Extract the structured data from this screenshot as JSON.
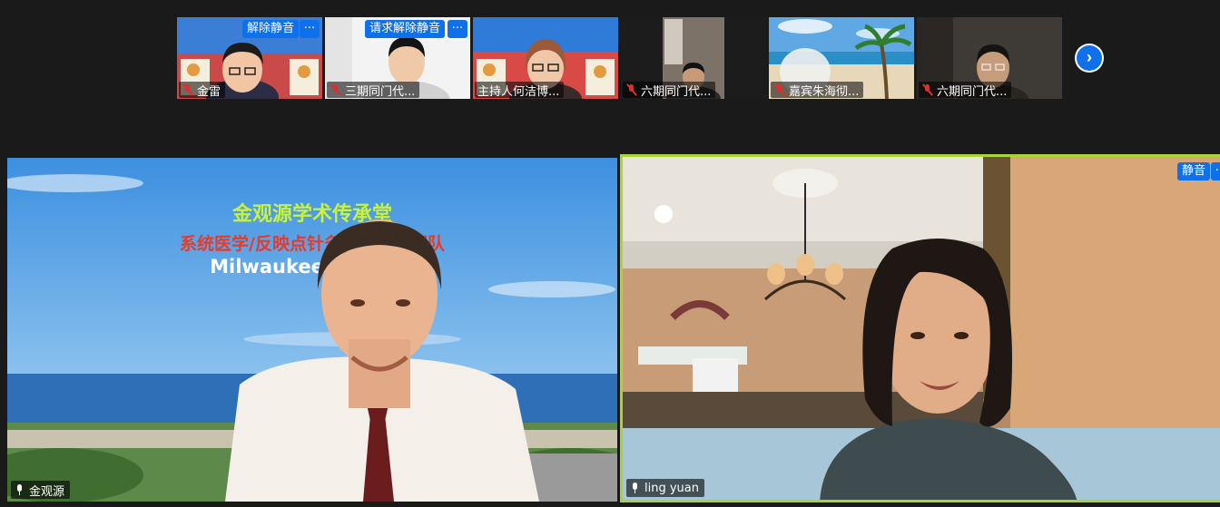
{
  "thumbnails": [
    {
      "name": "金雷",
      "unmute_button": "解除静音",
      "more_button": "···"
    },
    {
      "name": "三期同门代...",
      "unmute_button": "请求解除静音",
      "more_button": "···"
    },
    {
      "name": "主持人何洁博...",
      "unmute_button": "",
      "more_button": ""
    },
    {
      "name": "六期同门代...",
      "unmute_button": "",
      "more_button": ""
    },
    {
      "name": "嘉宾朱海彻...",
      "unmute_button": "",
      "more_button": ""
    },
    {
      "name": "六期同门代...",
      "unmute_button": "",
      "more_button": ""
    }
  ],
  "main_left": {
    "name": "金观源",
    "background_title": "金观源学术传承堂",
    "background_subtitle": "系统医学/反映点针灸国际科研团队",
    "background_location": "Milwaukee"
  },
  "main_right": {
    "name": "ling yuan",
    "mute_button": "静音",
    "more_button": "···"
  },
  "icons": {
    "next_page": "chevron-right-icon",
    "muted_mic": "mic-muted-icon",
    "active_mic": "mic-icon"
  },
  "colors": {
    "zoom_blue": "#0e71eb",
    "active_speaker_border": "#a9d534",
    "muted_red": "#e02d2d",
    "background": "#1a1a1a"
  }
}
